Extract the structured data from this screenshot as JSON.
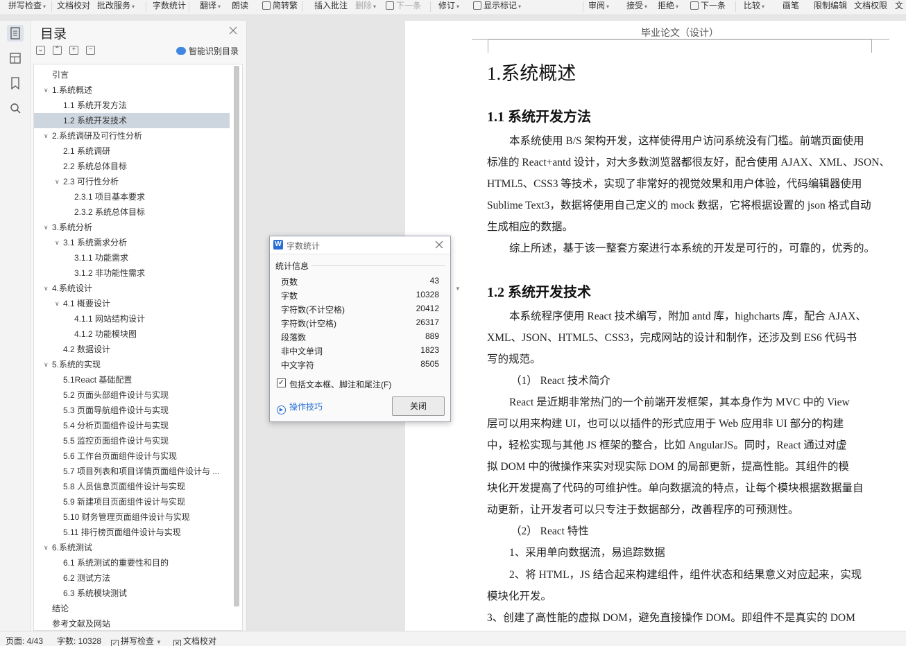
{
  "ribbon": {
    "items": [
      {
        "label": "拼写检查",
        "dropdown": true
      },
      {
        "label": "文档校对",
        "dropdown": false
      },
      {
        "label": "批改服务",
        "dropdown": true
      },
      {
        "label": "字数统计",
        "dropdown": false
      },
      {
        "label": "翻译",
        "dropdown": true
      },
      {
        "label": "朗读",
        "dropdown": false
      },
      {
        "label": "简转繁",
        "dropdown": false
      },
      {
        "label": "插入批注",
        "dropdown": false
      },
      {
        "label": "删除",
        "dropdown": true
      },
      {
        "label": "下一条",
        "dropdown": false
      },
      {
        "label": "修订",
        "dropdown": true
      },
      {
        "label": "显示标记",
        "dropdown": true
      },
      {
        "label": "审阅",
        "dropdown": true
      },
      {
        "label": "接受",
        "dropdown": true
      },
      {
        "label": "拒绝",
        "dropdown": true
      },
      {
        "label": "下一条",
        "dropdown": false
      },
      {
        "label": "比较",
        "dropdown": true
      },
      {
        "label": "画笔",
        "dropdown": false
      },
      {
        "label": "限制编辑",
        "dropdown": false
      },
      {
        "label": "文档权限",
        "dropdown": false
      },
      {
        "label": "文",
        "dropdown": false
      }
    ]
  },
  "toc": {
    "title": "目录",
    "smart_label": "智能识别目录",
    "items": [
      {
        "label": "引言",
        "level": 0,
        "expandable": false
      },
      {
        "label": "1.系统概述",
        "level": 0,
        "expandable": true
      },
      {
        "label": "1.1  系统开发方法",
        "level": 1,
        "expandable": false
      },
      {
        "label": "1.2  系统开发技术",
        "level": 1,
        "expandable": false,
        "selected": true
      },
      {
        "label": "2.系统调研及可行性分析",
        "level": 0,
        "expandable": true
      },
      {
        "label": "2.1 系统调研",
        "level": 1,
        "expandable": false
      },
      {
        "label": "2.2 系统总体目标",
        "level": 1,
        "expandable": false
      },
      {
        "label": "2.3 可行性分析",
        "level": 1,
        "expandable": true
      },
      {
        "label": "2.3.1 项目基本要求",
        "level": 2,
        "expandable": false
      },
      {
        "label": "2.3.2 系统总体目标",
        "level": 2,
        "expandable": false
      },
      {
        "label": "3.系统分析",
        "level": 0,
        "expandable": true
      },
      {
        "label": "3.1 系统需求分析",
        "level": 1,
        "expandable": true
      },
      {
        "label": "3.1.1 功能需求",
        "level": 2,
        "expandable": false
      },
      {
        "label": "3.1.2 非功能性需求",
        "level": 2,
        "expandable": false
      },
      {
        "label": "4.系统设计",
        "level": 0,
        "expandable": true
      },
      {
        "label": "4.1 概要设计",
        "level": 1,
        "expandable": true
      },
      {
        "label": "4.1.1 网站结构设计",
        "level": 2,
        "expandable": false
      },
      {
        "label": "4.1.2 功能模块图",
        "level": 2,
        "expandable": false
      },
      {
        "label": "4.2 数据设计",
        "level": 1,
        "expandable": false
      },
      {
        "label": "5.系统的实现",
        "level": 0,
        "expandable": true
      },
      {
        "label": "5.1React 基础配置",
        "level": 1,
        "expandable": false
      },
      {
        "label": "5.2 页面头部组件设计与实现",
        "level": 1,
        "expandable": false
      },
      {
        "label": "5.3 页面导航组件设计与实现",
        "level": 1,
        "expandable": false
      },
      {
        "label": "5.4 分析页面组件设计与实现",
        "level": 1,
        "expandable": false
      },
      {
        "label": "5.5 监控页面组件设计与实现",
        "level": 1,
        "expandable": false
      },
      {
        "label": "5.6 工作台页面组件设计与实现",
        "level": 1,
        "expandable": false
      },
      {
        "label": "5.7 项目列表和项目详情页面组件设计与 ...",
        "level": 1,
        "expandable": false
      },
      {
        "label": "5.8 人员信息页面组件设计与实现",
        "level": 1,
        "expandable": false
      },
      {
        "label": "5.9 新建项目页面组件设计与实现",
        "level": 1,
        "expandable": false
      },
      {
        "label": "5.10 财务管理页面组件设计与实现",
        "level": 1,
        "expandable": false
      },
      {
        "label": "5.11 排行榜页面组件设计与实现",
        "level": 1,
        "expandable": false
      },
      {
        "label": "6.系统测试",
        "level": 0,
        "expandable": true
      },
      {
        "label": "6.1 系统测试的重要性和目的",
        "level": 1,
        "expandable": false
      },
      {
        "label": "6.2 测试方法",
        "level": 1,
        "expandable": false
      },
      {
        "label": "6.3 系统模块测试",
        "level": 1,
        "expandable": false
      },
      {
        "label": "结论",
        "level": 0,
        "expandable": false
      },
      {
        "label": "参考文献及网站",
        "level": 0,
        "expandable": false
      }
    ]
  },
  "document": {
    "header": "毕业论文（设计）",
    "h1": "1.系统概述",
    "section1_title": "1.1  系统开发方法",
    "section1_lines": [
      "本系统使用 B/S 架构开发，这样使得用户访问系统没有门槛。前端页面使用",
      "标准的 React+antd 设计，对大多数浏览器都很友好，配合使用 AJAX、XML、JSON、",
      "HTML5、CSS3 等技术，实现了非常好的视觉效果和用户体验，代码编辑器使用",
      "Sublime Text3，数据将使用自己定义的 mock 数据，它将根据设置的 json 格式自动",
      "生成相应的数据。",
      "综上所述，基于该一整套方案进行本系统的开发是可行的，可靠的，优秀的。"
    ],
    "section2_title": "1.2  系统开发技术",
    "section2_lines": [
      "本系统程序使用 React 技术编写，附加 antd 库，highcharts 库，配合 AJAX、",
      "XML、JSON、HTML5、CSS3，完成网站的设计和制作，还涉及到 ES6 代码书",
      "写的规范。",
      "（1）  React 技术简介",
      "React 是近期非常热门的一个前端开发框架，其本身作为 MVC 中的 View",
      "层可以用来构建 UI，也可以以插件的形式应用于 Web 应用非 UI 部分的构建",
      "中，轻松实现与其他 JS 框架的整合，比如 AngularJS。同时，React 通过对虚",
      "拟 DOM 中的微操作来实对现实际 DOM 的局部更新，提高性能。其组件的模",
      "块化开发提高了代码的可维护性。单向数据流的特点，让每个模块根据数据量自",
      "动更新，让开发者可以只专注于数据部分，改善程序的可预测性。",
      "（2）  React 特性",
      "1、采用单向数据流，易追踪数据",
      "2、将 HTML，JS 结合起来构建组件，组件状态和结果意义对应起来，实现",
      "模块化开发。",
      "3、创建了高性能的虚拟 DOM，避免直接操作 DOM。即组件不是真实的 DOM"
    ]
  },
  "dialog": {
    "title": "字数统计",
    "section_label": "统计信息",
    "stats": [
      {
        "label": "页数",
        "value": "43"
      },
      {
        "label": "字数",
        "value": "10328"
      },
      {
        "label": "字符数(不计空格)",
        "value": "20412"
      },
      {
        "label": "字符数(计空格)",
        "value": "26317"
      },
      {
        "label": "段落数",
        "value": "889"
      },
      {
        "label": "非中文单词",
        "value": "1823"
      },
      {
        "label": "中文字符",
        "value": "8505"
      }
    ],
    "checkbox_label": "包括文本框、脚注和尾注(F)",
    "checkbox_checked": true,
    "tips_label": "操作技巧",
    "close_label": "关闭"
  },
  "status": {
    "page": "页面: 4/43",
    "words": "字数: 10328",
    "spell": "拼写检查",
    "proof": "文档校对"
  },
  "colors": {
    "accent": "#2b72d6",
    "toc_selected": "#cdd6df",
    "spell_error": "#dd3333"
  }
}
